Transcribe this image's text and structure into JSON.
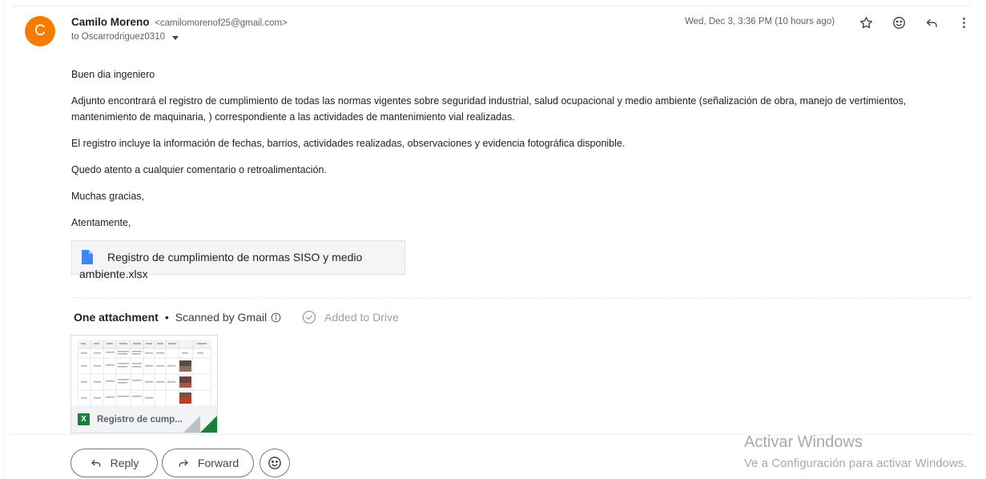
{
  "sender": {
    "initial": "C",
    "name": "Camilo Moreno",
    "email": "<camilomorenof25@gmail.com>",
    "to": "to Oscarrodriguez0310",
    "avatar_color": "#f57c00"
  },
  "date": "Wed, Dec 3, 3:36 PM (10 hours ago)",
  "header_icons": [
    "star-icon",
    "emoji-icon",
    "reply-icon",
    "more-vert-icon"
  ],
  "body": {
    "greeting": "Buen dia ingeniero",
    "paragraph1": "Adjunto encontrará el registro de cumplimiento de todas las normas vigentes sobre seguridad industrial, salud ocupacional y medio ambiente (señalización de obra, manejo de vertimientos, mantenimiento de maquinaria, ) correspondiente a las actividades de mantenimiento vial realizadas.",
    "paragraph2": "El registro incluye la información de fechas, barrios, actividades realizadas, observaciones y evidencia fotográfica disponible.",
    "paragraph3": "Quedo atento a cualquier comentario o retroalimentación.",
    "thanks": "Muchas gracias,",
    "closing": "Atentamente,"
  },
  "inline_attachment": {
    "line1": "Registro de cumplimiento de normas SISO y medio",
    "line2": "ambiente.xlsx"
  },
  "attachments_bar": {
    "count_label": "One attachment",
    "separator": "•",
    "scan_label": "Scanned by Gmail",
    "drive_label": "Added to Drive"
  },
  "attachment_card": {
    "name": "Registro de cump...",
    "type_badge": "X"
  },
  "actions": {
    "reply": "Reply",
    "forward": "Forward"
  },
  "watermark": {
    "line1": "Activar Windows",
    "line2": "Ve a Configuración para activar Windows."
  }
}
